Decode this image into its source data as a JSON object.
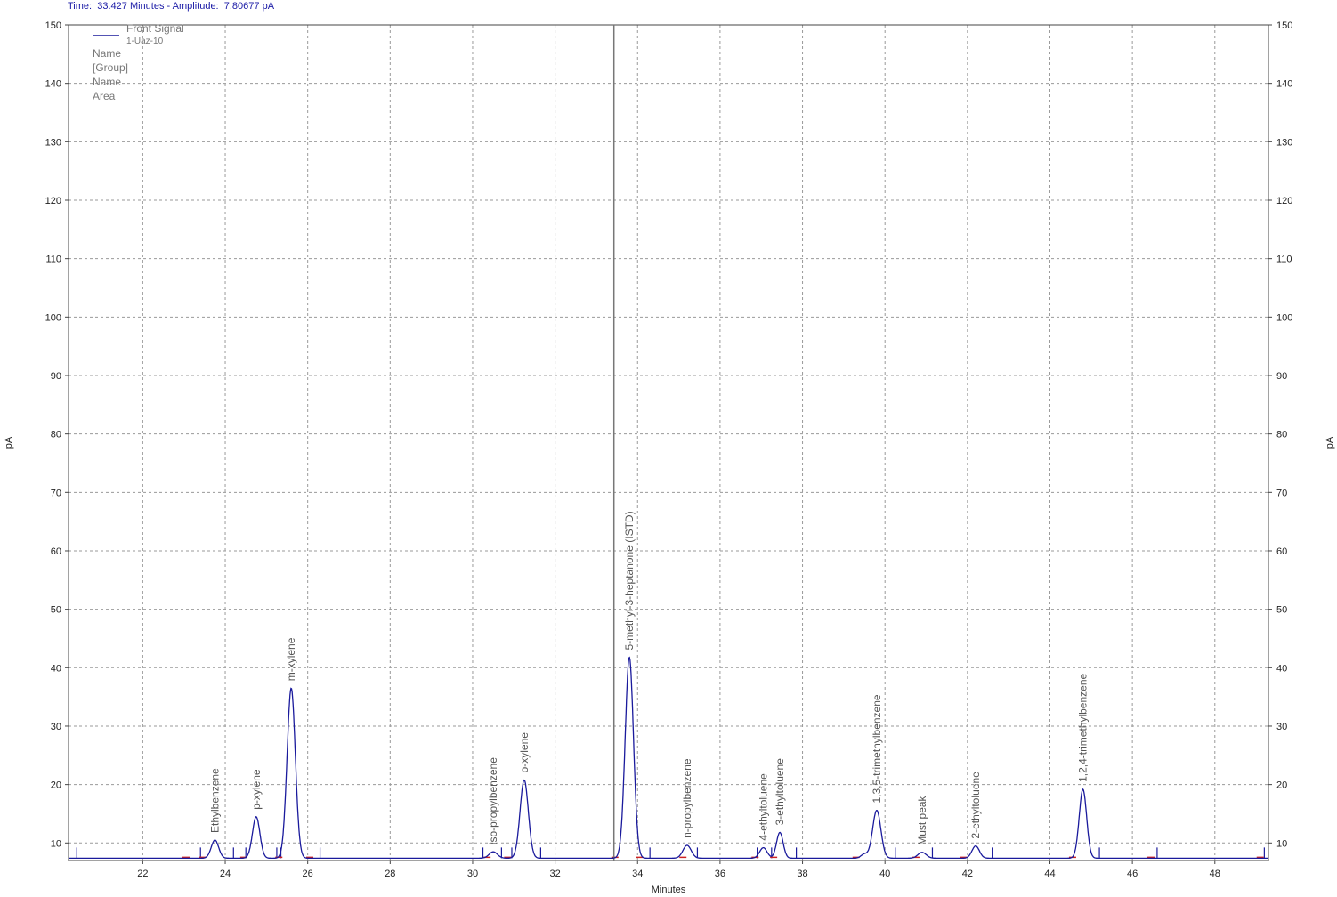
{
  "status": {
    "time_label": "Time:",
    "time_value": "33.427",
    "time_unit": "Minutes",
    "amplitude_label": "Amplitude:",
    "amplitude_value": "7.80677",
    "amplitude_unit": "pA"
  },
  "legend": {
    "signal_name": "Front Signal",
    "sample_name": "1-Uaz-10",
    "fields": [
      "Name",
      "[Group]",
      "Name",
      "Area"
    ]
  },
  "chart_data": {
    "type": "line",
    "title": "",
    "xlabel": "Minutes",
    "ylabel": "pA",
    "ylabel_right": "pA",
    "xlim": [
      20.2,
      49.3
    ],
    "ylim": [
      7,
      150
    ],
    "xticks": [
      22,
      24,
      26,
      28,
      30,
      32,
      34,
      36,
      38,
      40,
      42,
      44,
      46,
      48
    ],
    "yticks": [
      10,
      20,
      30,
      40,
      50,
      60,
      70,
      80,
      90,
      100,
      110,
      120,
      130,
      140,
      150
    ],
    "grid": true,
    "baseline": 7.4,
    "cursor_x": 33.427,
    "colors": {
      "signal": "#1a1a9c",
      "grid": "#9a9a9a",
      "marker": "#1a1a9c",
      "baseline_marker": "#cc2222",
      "cursor": "#777777"
    },
    "peaks": [
      {
        "name": "Ethylbenzene",
        "rt": 23.75,
        "height": 10.5,
        "width": 0.09
      },
      {
        "name": "p-xylene",
        "rt": 24.75,
        "height": 14.5,
        "width": 0.09
      },
      {
        "name": "m-xylene",
        "rt": 25.6,
        "height": 36.5,
        "width": 0.1
      },
      {
        "name": "iso-propylbenzene",
        "rt": 30.5,
        "height": 8.5,
        "width": 0.1
      },
      {
        "name": "o-xylene",
        "rt": 31.25,
        "height": 20.8,
        "width": 0.1
      },
      {
        "name": "5-methyl-3-heptanone (ISTD)",
        "rt": 33.8,
        "height": 41.8,
        "width": 0.1
      },
      {
        "name": "n-propylbenzene",
        "rt": 35.2,
        "height": 9.6,
        "width": 0.1
      },
      {
        "name": "4-ethyltoluene",
        "rt": 37.05,
        "height": 9.2,
        "width": 0.09
      },
      {
        "name": "3-ethyltoluene",
        "rt": 37.45,
        "height": 11.8,
        "width": 0.08
      },
      {
        "name": "1,3,5-trimethylbenzene",
        "rt": 39.8,
        "height": 15.6,
        "width": 0.1
      },
      {
        "name": "Must peak",
        "rt": 40.9,
        "height": 8.4,
        "width": 0.1
      },
      {
        "name": "2-ethyltoluene",
        "rt": 42.2,
        "height": 9.5,
        "width": 0.09
      },
      {
        "name": "1,2,4-trimethylbenzene",
        "rt": 44.8,
        "height": 19.2,
        "width": 0.09
      }
    ],
    "small_features": [
      {
        "rt": 39.5,
        "height": 8.1,
        "width": 0.08
      }
    ],
    "integration_markers": [
      20.4,
      23.4,
      24.2,
      24.5,
      25.25,
      25.35,
      26.3,
      30.25,
      30.7,
      30.95,
      31.65,
      34.3,
      35.45,
      36.9,
      37.25,
      37.85,
      40.25,
      41.15,
      42.6,
      45.2,
      46.6,
      49.2
    ],
    "baseline_markers": [
      23.05,
      23.45,
      24.45,
      25.3,
      26.05,
      30.35,
      30.85,
      33.45,
      34.05,
      35.1,
      36.85,
      37.3,
      39.3,
      40.75,
      41.9,
      44.55,
      46.45,
      49.1
    ]
  }
}
